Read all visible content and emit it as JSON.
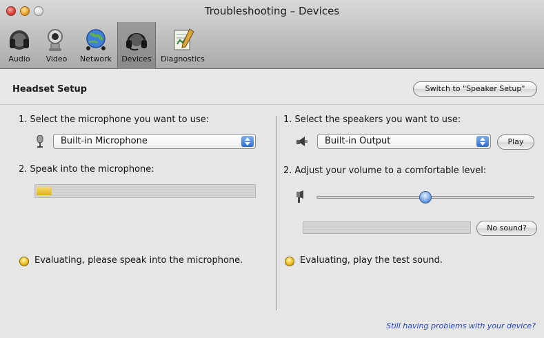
{
  "window": {
    "title": "Troubleshooting – Devices"
  },
  "toolbar": {
    "items": [
      {
        "label": "Audio",
        "icon": "headphones-icon",
        "selected": false
      },
      {
        "label": "Video",
        "icon": "camera-icon",
        "selected": false
      },
      {
        "label": "Network",
        "icon": "globe-network-icon",
        "selected": false
      },
      {
        "label": "Devices",
        "icon": "headset-icon",
        "selected": true
      },
      {
        "label": "Diagnostics",
        "icon": "notepad-pencil-icon",
        "selected": false
      }
    ]
  },
  "header": {
    "section_title": "Headset Setup",
    "switch_label": "Switch to \"Speaker Setup\""
  },
  "left": {
    "step1": "1. Select the microphone you want to use:",
    "mic_select": "Built-in Microphone",
    "step2": "2. Speak into the microphone:",
    "meter_level": 0.07,
    "status": "Evaluating, please speak into the microphone."
  },
  "right": {
    "step1": "1. Select the speakers you want to use:",
    "speaker_select": "Built-in Output",
    "play_label": "Play",
    "step2": "2. Adjust your volume to a comfortable level:",
    "volume": 0.5,
    "no_sound_label": "No sound?",
    "status": "Evaluating, play the test sound."
  },
  "footer": {
    "help_link": "Still having problems with your device?"
  },
  "colors": {
    "accent_blue": "#2e6fd0",
    "status_yellow": "#f0c020",
    "link_blue": "#2446c9"
  }
}
